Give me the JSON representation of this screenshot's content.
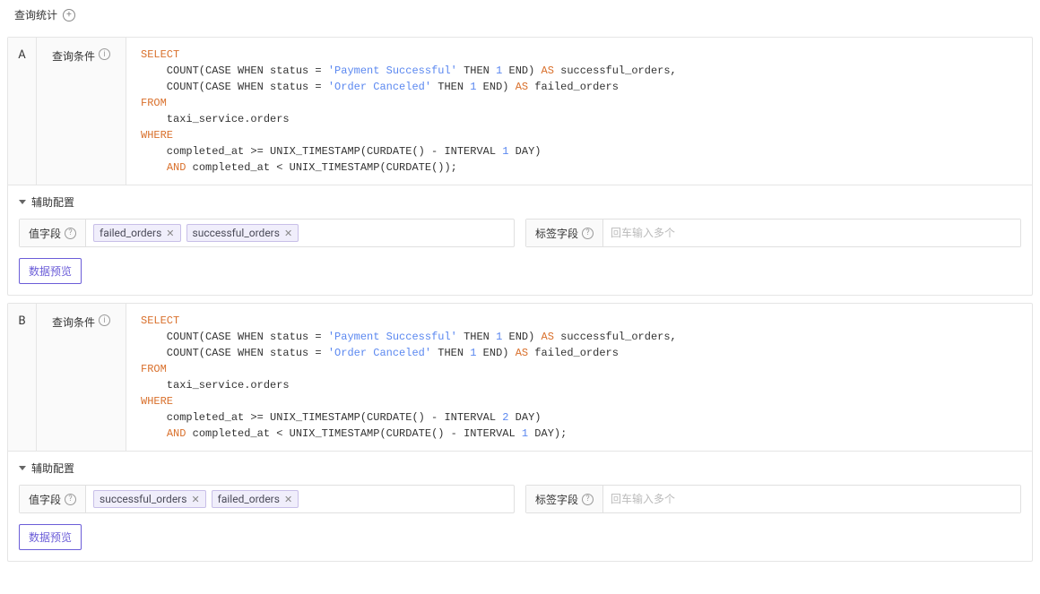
{
  "header": {
    "title": "查询统计"
  },
  "queries": [
    {
      "letter": "A",
      "condLabel": "查询条件",
      "auxLabel": "辅助配置",
      "valueFieldLabel": "值字段",
      "tagFieldLabel": "标签字段",
      "tagFieldPlaceholder": "回车输入多个",
      "previewLabel": "数据预览",
      "tags": [
        "failed_orders",
        "successful_orders"
      ],
      "sql": {
        "line1": "SELECT",
        "line2a": "    COUNT(CASE WHEN status = ",
        "line2str": "'Payment Successful'",
        "line2b": " THEN ",
        "line2num": "1",
        "line2c": " END) ",
        "line2as": "AS",
        "line2d": " successful_orders,",
        "line3a": "    COUNT(CASE WHEN status = ",
        "line3str": "'Order Canceled'",
        "line3b": " THEN ",
        "line3num": "1",
        "line3c": " END) ",
        "line3as": "AS",
        "line3d": " failed_orders",
        "line4": "FROM",
        "line5": "    taxi_service.orders",
        "line6": "WHERE",
        "line7a": "    completed_at >= UNIX_TIMESTAMP(CURDATE() - INTERVAL ",
        "line7num": "1",
        "line7b": " DAY)",
        "line8and": "AND",
        "line8a": " completed_at < UNIX_TIMESTAMP(CURDATE());"
      }
    },
    {
      "letter": "B",
      "condLabel": "查询条件",
      "auxLabel": "辅助配置",
      "valueFieldLabel": "值字段",
      "tagFieldLabel": "标签字段",
      "tagFieldPlaceholder": "回车输入多个",
      "previewLabel": "数据预览",
      "tags": [
        "successful_orders",
        "failed_orders"
      ],
      "sql": {
        "line1": "SELECT",
        "line2a": "    COUNT(CASE WHEN status = ",
        "line2str": "'Payment Successful'",
        "line2b": " THEN ",
        "line2num": "1",
        "line2c": " END) ",
        "line2as": "AS",
        "line2d": " successful_orders,",
        "line3a": "    COUNT(CASE WHEN status = ",
        "line3str": "'Order Canceled'",
        "line3b": " THEN ",
        "line3num": "1",
        "line3c": " END) ",
        "line3as": "AS",
        "line3d": " failed_orders",
        "line4": "FROM",
        "line5": "    taxi_service.orders",
        "line6": "WHERE",
        "line7a": "    completed_at >= UNIX_TIMESTAMP(CURDATE() - INTERVAL ",
        "line7num": "2",
        "line7b": " DAY)",
        "line8and": "AND",
        "line8a": " completed_at < UNIX_TIMESTAMP(CURDATE() - INTERVAL ",
        "line8num": "1",
        "line8b": " DAY);"
      }
    }
  ]
}
